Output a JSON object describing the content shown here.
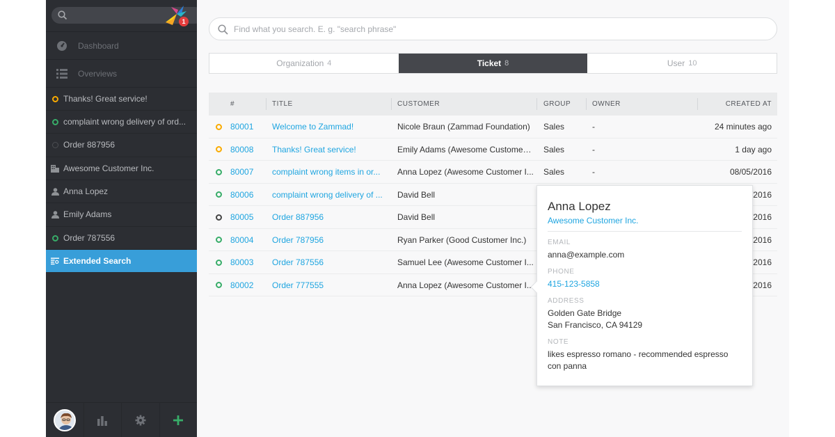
{
  "sidebar": {
    "search_placeholder": "",
    "notification_count": "1",
    "nav": [
      {
        "label": "Dashboard",
        "icon": "dashboard-icon"
      },
      {
        "label": "Overviews",
        "icon": "overviews-icon"
      }
    ],
    "tasks": [
      {
        "label": "Thanks! Great service!",
        "icon": "ticket-open-icon",
        "state": "pending"
      },
      {
        "label": "complaint wrong delivery of ord...",
        "icon": "ticket-open-icon",
        "state": "open"
      },
      {
        "label": "Order 887956",
        "icon": "ticket-closed-icon",
        "state": "closed"
      },
      {
        "label": "Awesome Customer Inc.",
        "icon": "organization-icon",
        "state": "org"
      },
      {
        "label": "Anna Lopez",
        "icon": "user-icon",
        "state": "user"
      },
      {
        "label": "Emily Adams",
        "icon": "user-icon",
        "state": "user"
      },
      {
        "label": "Order 787556",
        "icon": "ticket-open-icon",
        "state": "open"
      },
      {
        "label": "Extended Search",
        "icon": "search-list-icon",
        "state": "active"
      }
    ]
  },
  "search": {
    "placeholder": "Find what you search. E. g. \"search phrase\""
  },
  "tabs": [
    {
      "label": "Organization",
      "count": "4"
    },
    {
      "label": "Ticket",
      "count": "8"
    },
    {
      "label": "User",
      "count": "10"
    }
  ],
  "table": {
    "headers": {
      "number": "#",
      "title": "TITLE",
      "customer": "CUSTOMER",
      "group": "GROUP",
      "owner": "OWNER",
      "created": "CREATED AT"
    },
    "rows": [
      {
        "number": "80001",
        "title": "Welcome to Zammad!",
        "customer": "Nicole Braun (Zammad Foundation)",
        "group": "Sales",
        "owner": "-",
        "created": "24 minutes ago",
        "state": "pending"
      },
      {
        "number": "80008",
        "title": "Thanks! Great service!",
        "customer": "Emily Adams (Awesome Customer ...",
        "group": "Sales",
        "owner": "-",
        "created": "1 day ago",
        "state": "pending"
      },
      {
        "number": "80007",
        "title": "complaint wrong items in or...",
        "customer": "Anna Lopez (Awesome Customer I...",
        "group": "Sales",
        "owner": "-",
        "created": "08/05/2016",
        "state": "open"
      },
      {
        "number": "80006",
        "title": "complaint wrong delivery of ...",
        "customer": "David Bell",
        "group": "",
        "owner": "",
        "created": "/2016",
        "state": "open"
      },
      {
        "number": "80005",
        "title": "Order 887956",
        "customer": "David Bell",
        "group": "",
        "owner": "",
        "created": "/2016",
        "state": "closed"
      },
      {
        "number": "80004",
        "title": "Order 787956",
        "customer": "Ryan Parker (Good Customer Inc.)",
        "group": "",
        "owner": "",
        "created": "/2016",
        "state": "open"
      },
      {
        "number": "80003",
        "title": "Order 787556",
        "customer": "Samuel Lee (Awesome Customer I...",
        "group": "",
        "owner": "",
        "created": "/2016",
        "state": "open"
      },
      {
        "number": "80002",
        "title": "Order 777555",
        "customer": "Anna Lopez (Awesome Customer I...",
        "group": "",
        "owner": "",
        "created": "/2016",
        "state": "open"
      }
    ]
  },
  "popover": {
    "name": "Anna Lopez",
    "organization": "Awesome Customer Inc.",
    "email_label": "EMAIL",
    "email": "anna@example.com",
    "phone_label": "PHONE",
    "phone": "415-123-5858",
    "address_label": "ADDRESS",
    "address_line1": "Golden Gate Bridge",
    "address_line2": "San Francisco, CA 94129",
    "note_label": "NOTE",
    "note": "likes espresso romano - recommended espresso con panna"
  },
  "colors": {
    "accent": "#389ed9",
    "link": "#1fa5e0",
    "pending": "#faab00",
    "open": "#38ad69",
    "sidebar_bg": "#2c2e33"
  }
}
